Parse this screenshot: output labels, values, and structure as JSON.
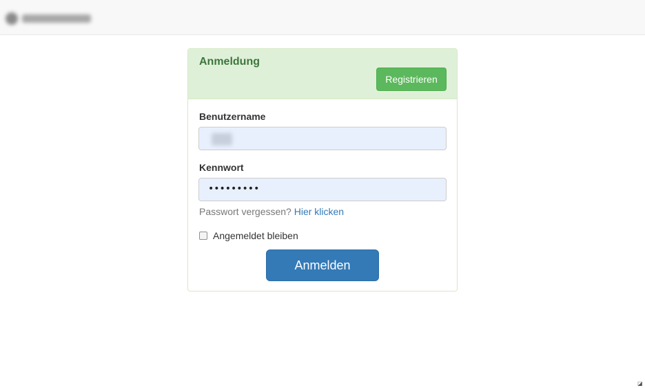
{
  "panel": {
    "title": "Anmeldung",
    "register_label": "Registrieren"
  },
  "form": {
    "username_label": "Benutzername",
    "password_label": "Kennwort",
    "password_value": "•••••••••",
    "forgot_text": "Passwort vergessen?",
    "forgot_link": "Hier klicken",
    "remember_label": "Angemeldet bleiben",
    "remember_checked": false,
    "login_label": "Anmelden"
  },
  "colors": {
    "heading_bg": "#dff0d8",
    "heading_text": "#3c763d",
    "register_button": "#5cb85c",
    "login_button": "#337ab7",
    "link": "#337ab7",
    "input_bg": "#e8f0fe"
  },
  "icons": {
    "brand": "brand-logo-icon",
    "corner": "resize-corner-icon"
  }
}
